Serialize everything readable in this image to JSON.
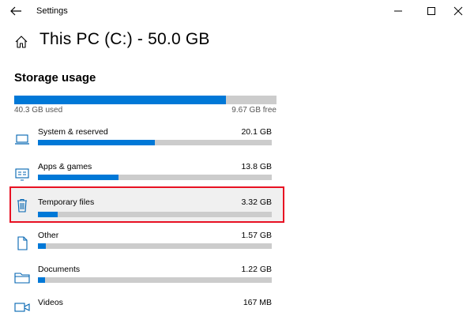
{
  "window": {
    "app_title": "Settings",
    "back_icon": "arrow-left-icon",
    "minimize_icon": "minimize-icon",
    "maximize_icon": "maximize-icon",
    "close_icon": "close-icon"
  },
  "header": {
    "home_icon": "home-icon",
    "title": "This PC (C:) - 50.0 GB"
  },
  "storage": {
    "section_title": "Storage usage",
    "used_text": "40.3 GB used",
    "free_text": "9.67 GB free",
    "used_fraction": 0.806
  },
  "categories": [
    {
      "icon": "laptop-icon",
      "label": "System & reserved",
      "size": "20.1 GB",
      "fraction": 0.5,
      "highlighted": false
    },
    {
      "icon": "apps-icon",
      "label": "Apps & games",
      "size": "13.8 GB",
      "fraction": 0.345,
      "highlighted": false
    },
    {
      "icon": "trash-icon",
      "label": "Temporary files",
      "size": "3.32 GB",
      "fraction": 0.085,
      "highlighted": true
    },
    {
      "icon": "other-file-icon",
      "label": "Other",
      "size": "1.57 GB",
      "fraction": 0.035,
      "highlighted": false
    },
    {
      "icon": "folder-icon",
      "label": "Documents",
      "size": "1.22 GB",
      "fraction": 0.03,
      "highlighted": false
    },
    {
      "icon": "video-icon",
      "label": "Videos",
      "size": "167 MB",
      "fraction": 0.005,
      "highlighted": false
    }
  ],
  "colors": {
    "accent": "#0078d7",
    "bar_track": "#cccccc",
    "highlight_border": "#e81123",
    "highlight_bg": "#f0f0f0",
    "icon_blue": "#0063b1"
  }
}
